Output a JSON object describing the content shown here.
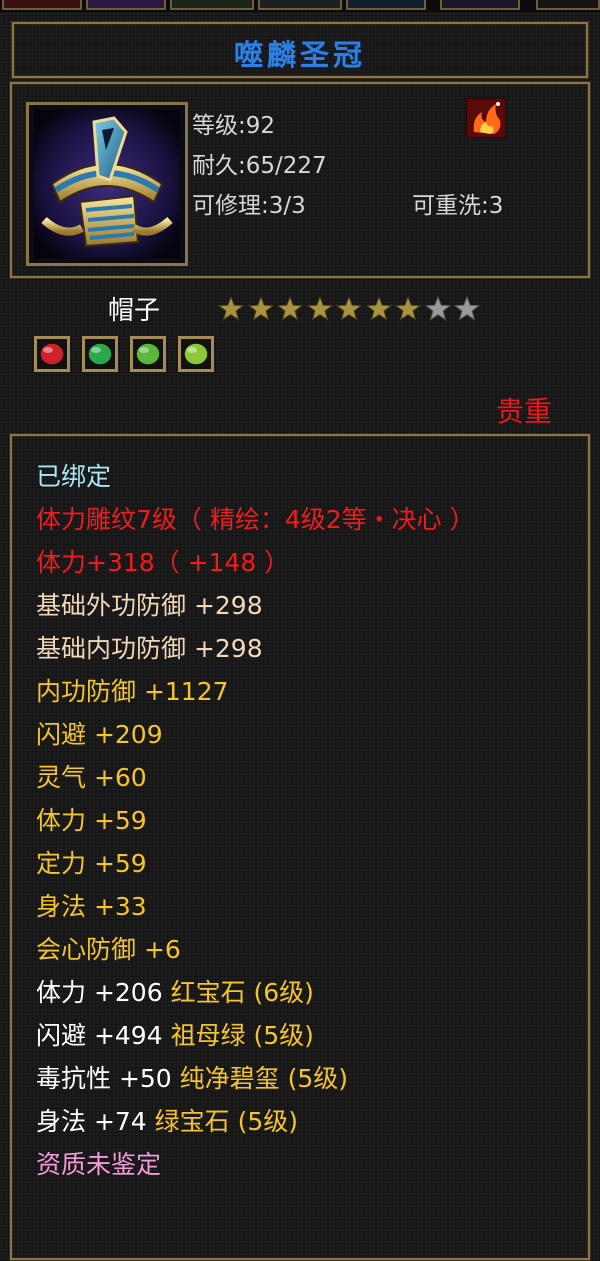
{
  "colors": {
    "frame_gold": "#8a7549",
    "title_blue": "#2e7fe0",
    "bound_cyan": "#a8e8f4",
    "red": "#ee1c1c",
    "base_tan": "#f0d8b8",
    "gold": "#f5c42a",
    "white": "#ffffff",
    "pink": "#f49ad8"
  },
  "item": {
    "title": "噬麟圣冠",
    "icon": "crown-helmet-icon",
    "level_label": "等级:92",
    "durability_label": "耐久:65/227",
    "repair_label": "可修理:3/3",
    "rewash_label": "可重洗:3",
    "badge_icon": "flame-badge-icon",
    "type_label": "帽子",
    "rarity_label": "贵重"
  },
  "stars": {
    "filled": 7,
    "total": 9
  },
  "sockets": [
    {
      "gem": "red-gem-icon",
      "color": "#d0202a"
    },
    {
      "gem": "green-gem-icon",
      "color": "#2aa84a"
    },
    {
      "gem": "green-gem-icon",
      "color": "#5ab83a"
    },
    {
      "gem": "green-gem-icon",
      "color": "#8cc83a"
    }
  ],
  "attributes": [
    {
      "text": "已绑定",
      "color": "#a8e8f4"
    },
    {
      "text": "体力雕纹7级（ 精绘：4级2等・决心 ）",
      "color": "#ee1c1c"
    },
    {
      "text": "体力+318（ +148 ）",
      "color": "#ee1c1c"
    },
    {
      "text": "基础外功防御 +298",
      "color": "#f0d8b8"
    },
    {
      "text": "基础内功防御 +298",
      "color": "#f0d8b8"
    },
    {
      "text": "内功防御 +1127",
      "color": "#f5c42a"
    },
    {
      "text": "闪避 +209",
      "color": "#f5c42a"
    },
    {
      "text": "灵气 +60",
      "color": "#f5c42a"
    },
    {
      "text": "体力 +59",
      "color": "#f5c42a"
    },
    {
      "text": "定力 +59",
      "color": "#f5c42a"
    },
    {
      "text": "身法 +33",
      "color": "#f5c42a"
    },
    {
      "text": "会心防御 +6",
      "color": "#f5c42a"
    },
    {
      "text": "体力 +206 红宝石 (6级)",
      "color": "#ffffff",
      "split": [
        "体力 +206 ",
        "红宝石 (6级)"
      ]
    },
    {
      "text": "闪避 +494 祖母绿 (5级)",
      "color": "#ffffff",
      "split": [
        "闪避 +494 ",
        "祖母绿 (5级)"
      ]
    },
    {
      "text": "毒抗性 +50 纯净碧玺 (5级)",
      "color": "#ffffff",
      "split": [
        "毒抗性 +50 ",
        "纯净碧玺 (5级)"
      ]
    },
    {
      "text": "身法 +74 绿宝石 (5级)",
      "color": "#ffffff",
      "split": [
        "身法 +74 ",
        "绿宝石 (5级)"
      ]
    },
    {
      "text": "资质未鉴定",
      "color": "#f49ad8"
    }
  ]
}
